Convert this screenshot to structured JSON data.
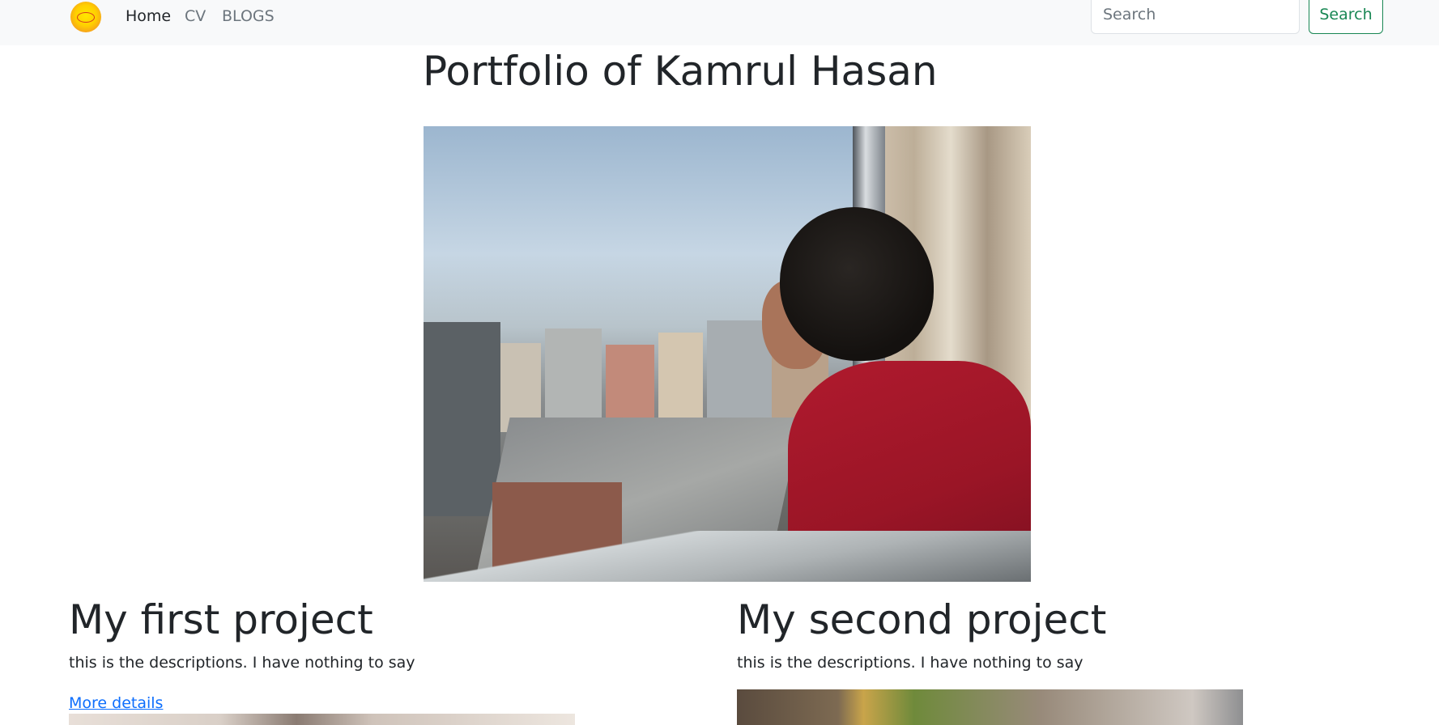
{
  "navbar": {
    "logo_alt": "logo",
    "links": [
      {
        "label": "Home",
        "active": true
      },
      {
        "label": "CV",
        "active": false
      },
      {
        "label": "BLOGS",
        "active": false
      }
    ],
    "search": {
      "placeholder": "Search",
      "value": "",
      "button_label": "Search"
    }
  },
  "page": {
    "title": "Portfolio of Kamrul Hasan",
    "hero_image_alt": "Man in red t-shirt looking out a high-rise window over a city"
  },
  "projects": [
    {
      "title": "My first project",
      "description": "this is the descriptions. I have nothing to say",
      "link_label": "More details"
    },
    {
      "title": "My second project",
      "description": "this is the descriptions. I have nothing to say"
    }
  ],
  "colors": {
    "navbar_bg": "#f8f9fa",
    "link": "#0d6efd",
    "success": "#198754",
    "text": "#212529",
    "muted": "#6c757d"
  }
}
